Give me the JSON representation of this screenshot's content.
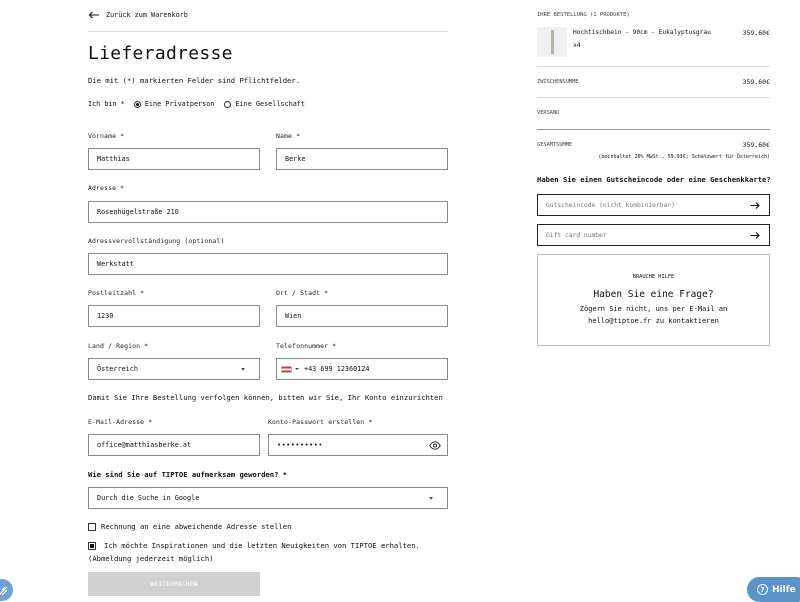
{
  "back_link": "Zurück zum Warenkorb",
  "heading": "Lieferadresse",
  "required_note": "Die mit (*) markierten Felder sind Pflichtfelder.",
  "customer_type": {
    "label": "Ich bin *",
    "options": [
      "Eine Privatperson",
      "Eine Gesellschaft"
    ],
    "selected": "Eine Privatperson"
  },
  "form": {
    "first_name": {
      "label": "Vorname *",
      "value": "Matthias"
    },
    "last_name": {
      "label": "Name *",
      "value": "Berke"
    },
    "address": {
      "label": "Adresse *",
      "value": "Rosenhügelstraße 210"
    },
    "address2": {
      "label": "Adressvervollständigung (optional)",
      "value": "Werkstatt"
    },
    "postcode": {
      "label": "Postleitzahl *",
      "value": "1230"
    },
    "city": {
      "label": "Ort / Stadt *",
      "value": "Wien"
    },
    "country": {
      "label": "Land / Region *",
      "value": "Österreich"
    },
    "phone": {
      "label": "Telefonnummer  *",
      "value": "+43 699 12360124"
    },
    "account_note": "Damit Sie Ihre Bestellung verfolgen können, bitten wir Sie, Ihr Konto einzurichten",
    "email": {
      "label": "E-Mail-Adresse *",
      "value": "office@matthiasberke.at"
    },
    "password": {
      "label": "Konto-Passwort erstellen *",
      "value": "••••••••••"
    },
    "source_question": "Wie sind Sie auf TIPTOE aufmerksam geworden? *",
    "source_value": "Durch die Suche in Google",
    "billing_checkbox": "Rechnung an eine abweichende Adresse stellen",
    "newsletter_line1": "Ich möchte Inspirationen und die letzten Neuigkeiten von TIPTOE erhalten.",
    "newsletter_line2": "(Abmeldung jederzeit möglich)",
    "continue_button": "WEITERMACHEN"
  },
  "order": {
    "heading": "IHRE BESTELLUNG (1 PRODUKTE)",
    "product_name": "Hochtischbein - 90cm - Eukalyptusgrau",
    "product_qty": "x4",
    "product_price": "359.60€",
    "subtotal_label": "ZWISCHENSUMME",
    "subtotal_value": "359.60€",
    "shipping_label": "VERSAND",
    "total_label": "GESAMTSUMME",
    "total_value": "359.60€",
    "tax_note": "(beinhaltet 20% MwSt., 59.93€; Schätzwert für Österreich)"
  },
  "voucher": {
    "heading": "Haben Sie einen Gutscheincode oder eine Geschenkkarte?",
    "code_placeholder": "Gutscheincode (nicht kombinierbar)",
    "gift_placeholder": "Gift card number"
  },
  "help_box": {
    "kicker": "BRAUCHE HILFE",
    "title": "Haben Sie eine Frage?",
    "line1": "Zögern Sie nicht, uns per E-Mail an",
    "line2": "hello@tiptoe.fr zu kontaktieren"
  },
  "help_button": "Hilfe",
  "colors": {
    "help_button": "#5b93c7",
    "disabled_button": "#d0d0d0",
    "flag_red": "#d92c2c"
  }
}
